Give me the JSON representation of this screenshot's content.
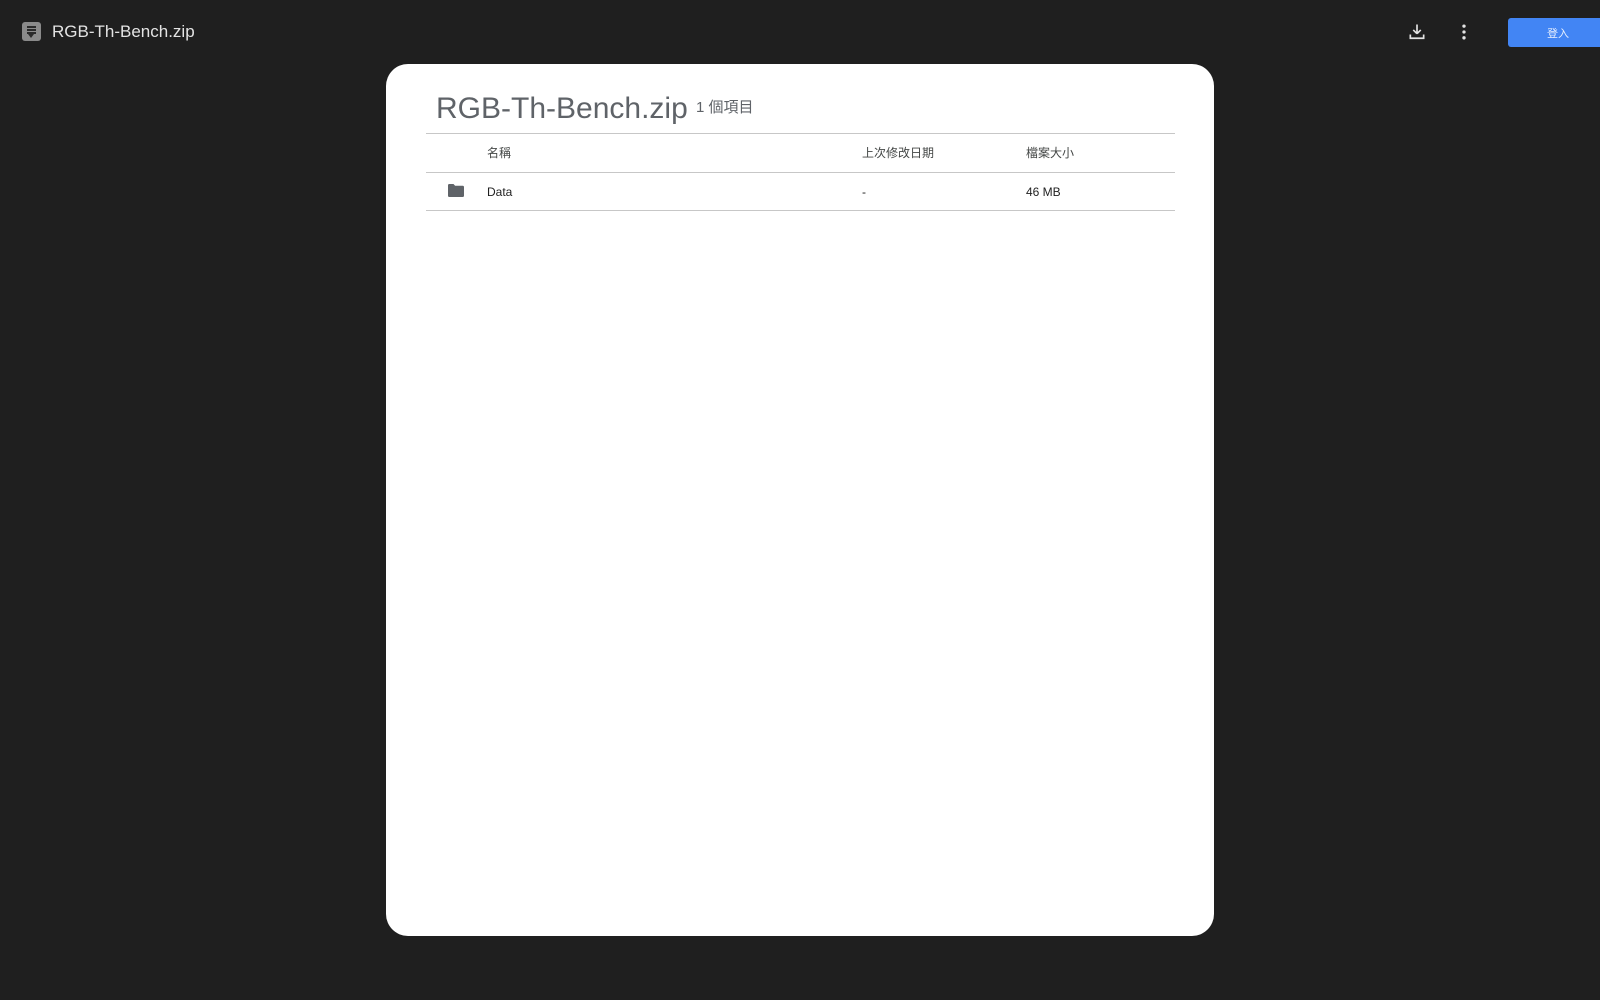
{
  "app": {
    "title": "RGB-Th-Bench.zip"
  },
  "toolbar": {
    "download_icon": "download-icon",
    "more_icon": "more-vert-icon",
    "login_label": "登入"
  },
  "archive": {
    "title": "RGB-Th-Bench.zip",
    "item_count": "1 個項目"
  },
  "table": {
    "headers": {
      "name": "名稱",
      "modified": "上次修改日期",
      "size": "檔案大小"
    },
    "rows": [
      {
        "icon": "folder-icon",
        "name": "Data",
        "modified": "-",
        "size": "46 MB"
      }
    ]
  },
  "colors": {
    "background": "#1f1f1f",
    "accent": "#4285f4",
    "panel": "#ffffff"
  }
}
